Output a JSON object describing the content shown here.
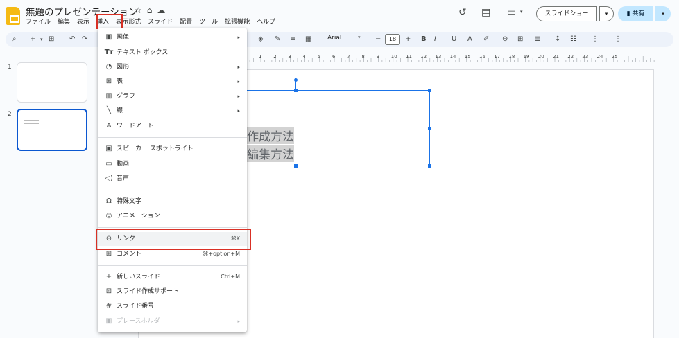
{
  "app": {
    "title": "無題のプレゼンテーション"
  },
  "menubar": [
    "ファイル",
    "編集",
    "表示",
    "挿入",
    "表示形式",
    "スライド",
    "配置",
    "ツール",
    "拡張機能",
    "ヘルプ"
  ],
  "header": {
    "slideshow_label": "スライドショー",
    "share_label": "共有"
  },
  "toolbar": {
    "font": "Arial",
    "font_size": "18"
  },
  "ruler": [
    "1",
    "2",
    "3",
    "4",
    "5",
    "6",
    "7",
    "8",
    "9",
    "10",
    "11",
    "12",
    "13",
    "14",
    "15",
    "16",
    "17",
    "18",
    "19",
    "20",
    "21",
    "22",
    "23",
    "24",
    "25"
  ],
  "slides": [
    {
      "number": "1"
    },
    {
      "number": "2"
    }
  ],
  "canvas": {
    "line1": "作成方法",
    "line2": "編集方法"
  },
  "insert_menu": {
    "image": "画像",
    "textbox": "テキスト ボックス",
    "shape": "図形",
    "table": "表",
    "chart": "グラフ",
    "line": "線",
    "wordart": "ワードアート",
    "spotlight": "スピーカー スポットライト",
    "video": "動画",
    "audio": "音声",
    "special_chars": "特殊文字",
    "animation": "アニメーション",
    "link": "リンク",
    "link_shortcut": "⌘K",
    "comment": "コメント",
    "comment_shortcut": "⌘+option+M",
    "new_slide": "新しいスライド",
    "new_slide_shortcut": "Ctrl+M",
    "slide_assist": "スライド作成サポート",
    "slide_number": "スライド番号",
    "placeholder": "プレースホルダ"
  },
  "colors": {
    "highlight_outline": "#d93025",
    "selection": "#1a73e8",
    "share_bg": "#c2e7ff"
  }
}
